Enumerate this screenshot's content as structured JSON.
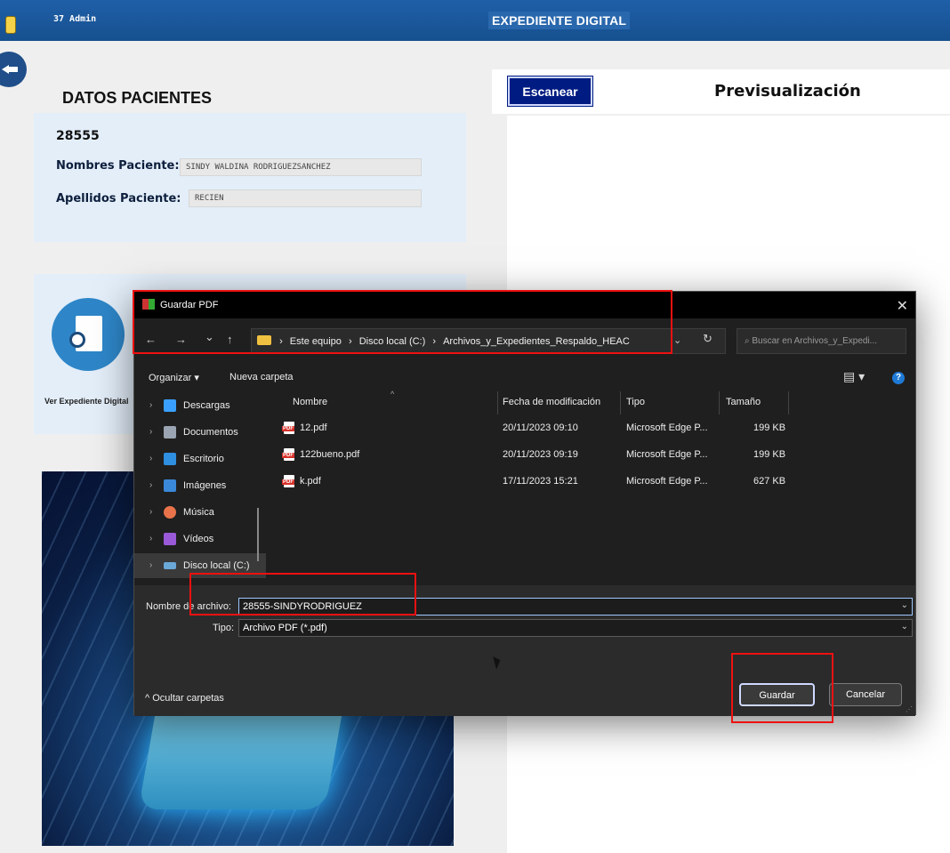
{
  "header": {
    "user": "37  Admin",
    "title": "EXPEDIENTE DIGITAL"
  },
  "patient": {
    "section_title": "DATOS PACIENTES",
    "id": "28555",
    "names_label": "Nombres Paciente:",
    "names_value": "SINDY WALDINA RODRIGUEZSANCHEZ",
    "surnames_label": "Apellidos Paciente:",
    "surnames_value": "RECIEN"
  },
  "expediente": {
    "label": "Ver Expediente Digital"
  },
  "right": {
    "scan_label": "Escanear",
    "preview_title": "Previsualización"
  },
  "dialog": {
    "title": "Guardar PDF",
    "close": "✕",
    "nav": {
      "back": "←",
      "forward": "→",
      "down": "⌄",
      "up": "↑"
    },
    "breadcrumb": {
      "sep": "›",
      "parts": [
        "Este equipo",
        "Disco local (C:)",
        "Archivos_y_Expedientes_Respaldo_HEAC"
      ]
    },
    "address_dropdown": "⌄",
    "refresh": "↻",
    "search_placeholder": "⌕  Buscar en Archivos_y_Expedi...",
    "toolbar": {
      "organize": "Organizar ▾",
      "new_folder": "Nueva carpeta",
      "view": "▤ ▾",
      "help": "?"
    },
    "nav_pane": [
      {
        "label": "Descargas",
        "icon": "download-icon",
        "color": "#3aa0ff"
      },
      {
        "label": "Documentos",
        "icon": "documents-icon",
        "color": "#9aa4b2"
      },
      {
        "label": "Escritorio",
        "icon": "desktop-icon",
        "color": "#2f8fe0"
      },
      {
        "label": "Imágenes",
        "icon": "images-icon",
        "color": "#3a88d8"
      },
      {
        "label": "Música",
        "icon": "music-icon",
        "color": "#e8734a"
      },
      {
        "label": "Vídeos",
        "icon": "videos-icon",
        "color": "#9a5ad8"
      },
      {
        "label": "Disco local (C:)",
        "icon": "drive-icon",
        "color": "#6aa8d8"
      }
    ],
    "columns": [
      "Nombre",
      "Fecha de modificación",
      "Tipo",
      "Tamaño"
    ],
    "files": [
      {
        "name": "12.pdf",
        "date": "20/11/2023 09:10",
        "type": "Microsoft Edge P...",
        "size": "199 KB"
      },
      {
        "name": "122bueno.pdf",
        "date": "20/11/2023 09:19",
        "type": "Microsoft Edge P...",
        "size": "199 KB"
      },
      {
        "name": "k.pdf",
        "date": "17/11/2023 15:21",
        "type": "Microsoft Edge P...",
        "size": "627 KB"
      }
    ],
    "filename_label": "Nombre de archivo:",
    "filename_value": "28555-SINDYRODRIGUEZ",
    "type_label": "Tipo:",
    "type_value": "Archivo PDF (*.pdf)",
    "hide_folders": "^  Ocultar carpetas",
    "save_label": "Guardar",
    "cancel_label": "Cancelar"
  },
  "colors": {
    "header_blue": "#1f5fa8",
    "scan_button": "#001b82",
    "highlight_red": "#ee1111",
    "dialog_bg": "#1f1f1f"
  }
}
